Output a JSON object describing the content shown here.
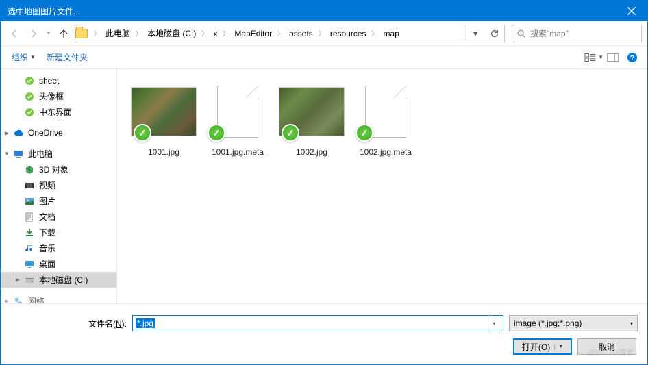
{
  "title": "选中地图图片文件...",
  "nav": {
    "breadcrumbs": [
      "此电脑",
      "本地磁盘 (C:)",
      "x",
      "MapEditor",
      "assets",
      "resources",
      "map"
    ],
    "search_placeholder": "搜索\"map\""
  },
  "toolbar": {
    "organize": "组织",
    "newfolder": "新建文件夹"
  },
  "tree": {
    "items": [
      {
        "label": "sheet",
        "icon": "folder-green",
        "depth": 2
      },
      {
        "label": "头像框",
        "icon": "folder-green",
        "depth": 2
      },
      {
        "label": "中东界面",
        "icon": "folder-green",
        "depth": 2
      },
      {
        "spacer": true
      },
      {
        "label": "OneDrive",
        "icon": "cloud",
        "depth": 1,
        "caret": "right"
      },
      {
        "spacer": true
      },
      {
        "label": "此电脑",
        "icon": "pc",
        "depth": 1,
        "caret": "down"
      },
      {
        "label": "3D 对象",
        "icon": "3d",
        "depth": 2
      },
      {
        "label": "视频",
        "icon": "video",
        "depth": 2
      },
      {
        "label": "图片",
        "icon": "pictures",
        "depth": 2
      },
      {
        "label": "文档",
        "icon": "docs",
        "depth": 2
      },
      {
        "label": "下载",
        "icon": "downloads",
        "depth": 2
      },
      {
        "label": "音乐",
        "icon": "music",
        "depth": 2
      },
      {
        "label": "桌面",
        "icon": "desktop",
        "depth": 2
      },
      {
        "label": "本地磁盘 (C:)",
        "icon": "disk",
        "depth": 2,
        "selected": true,
        "caret": "right"
      },
      {
        "spacer": true
      },
      {
        "label": "网络",
        "icon": "network",
        "depth": 1,
        "caret": "right",
        "cut": true
      }
    ]
  },
  "files": [
    {
      "name": "1001.jpg",
      "kind": "image",
      "variant": 1
    },
    {
      "name": "1001.jpg.meta",
      "kind": "doc"
    },
    {
      "name": "1002.jpg",
      "kind": "image",
      "variant": 2
    },
    {
      "name": "1002.jpg.meta",
      "kind": "doc"
    }
  ],
  "bottom": {
    "filename_label_pre": "文件名(",
    "filename_label_key": "N",
    "filename_label_post": "):",
    "filename_value": "*.jpg",
    "filter": "image (*.jpg;*.png)",
    "open": "打开(O)",
    "cancel": "取消"
  },
  "watermark": "@51CTO博客"
}
